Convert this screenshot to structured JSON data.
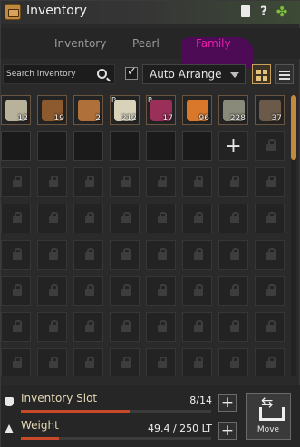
{
  "window": {
    "title": "Inventory"
  },
  "tabs": [
    {
      "label": "Inventory",
      "active": false
    },
    {
      "label": "Pearl",
      "active": false
    },
    {
      "label": "Family",
      "active": true
    }
  ],
  "toolbar": {
    "search_placeholder": "Search inventory",
    "auto_arrange_checked": true,
    "arrange_label": "Auto Arrange"
  },
  "items": [
    {
      "name": "",
      "count": "12",
      "color": "#b8b29a",
      "pinned": false
    },
    {
      "name": "",
      "count": "19",
      "color": "#8c5a2e",
      "pinned": false
    },
    {
      "name": "",
      "count": "2",
      "color": "#b0703a",
      "pinned": false
    },
    {
      "name": "",
      "count": "212",
      "color": "#d8d2b8",
      "pinned": true
    },
    {
      "name": "",
      "count": "17",
      "color": "#9a2f5a",
      "pinned": true
    },
    {
      "name": "",
      "count": "96",
      "color": "#d9782b",
      "pinned": false
    },
    {
      "name": "",
      "count": "228",
      "color": "#8a8a7a",
      "pinned": false
    },
    {
      "name": "",
      "count": "37",
      "color": "#6b5a4a",
      "pinned": false
    }
  ],
  "slots": {
    "empty_count": 6,
    "expand_slot": true,
    "locked_rows": 7,
    "columns": 8
  },
  "footer": {
    "inventory_slot_label": "Inventory Slot",
    "inventory_slot_value": "8/14",
    "inventory_slot_fill": 0.57,
    "weight_label": "Weight",
    "weight_value": "49.4 / 250 LT",
    "weight_fill": 0.2,
    "move_label": "Move"
  },
  "colors": {
    "accent": "#e81ea8",
    "scroll": "#c38a3e",
    "bar": "#c8482a"
  }
}
